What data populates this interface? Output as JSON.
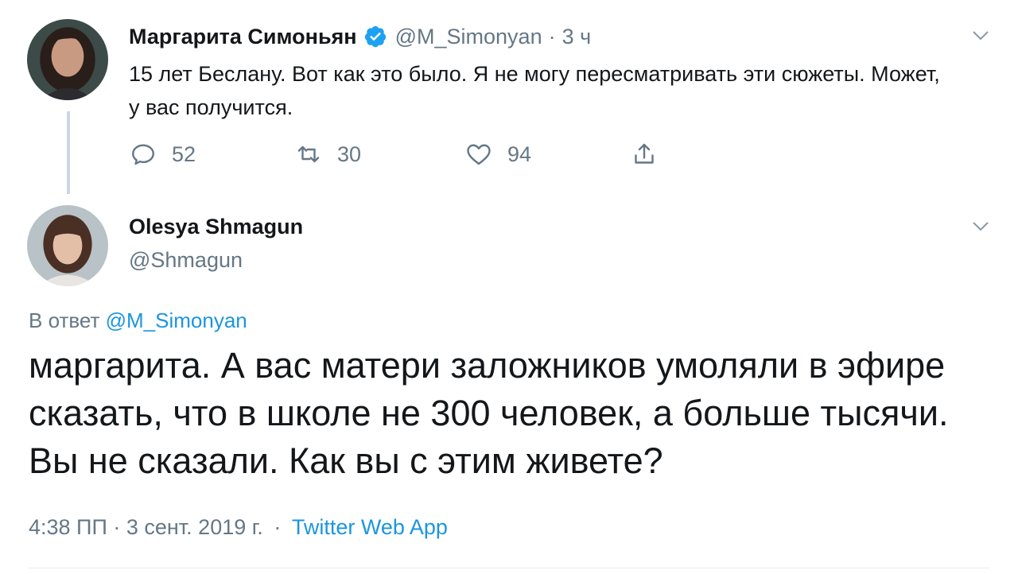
{
  "tweet1": {
    "author_name": "Маргарита Симоньян",
    "handle": "@M_Simonyan",
    "separator": "·",
    "time": "3 ч",
    "text": "15 лет Беслану. Вот как это было. Я не могу пересматривать эти сюжеты. Может, у вас получится.",
    "actions": {
      "reply_count": "52",
      "retweet_count": "30",
      "like_count": "94"
    }
  },
  "tweet2": {
    "author_name": "Olesya Shmagun",
    "handle": "@Shmagun",
    "reply_prefix": "В ответ",
    "reply_handle": "@M_Simonyan",
    "text": "маргарита. А вас матери заложников умоляли в эфире сказать, что в школе не 300 человек, а больше тысячи. Вы не сказали. Как вы с этим живете?",
    "timestamp": "4:38 ПП · 3 сент. 2019 г.",
    "separator": "·",
    "source": "Twitter Web App"
  },
  "colors": {
    "text": "#14171a",
    "muted": "#657786",
    "accent": "#1b95e0",
    "thread_line": "#ccd6dd"
  },
  "icons": [
    "avatar-margarita",
    "verified-badge-icon",
    "chevron-down-icon",
    "reply-icon",
    "retweet-icon",
    "like-icon",
    "share-icon",
    "avatar-olesya"
  ]
}
